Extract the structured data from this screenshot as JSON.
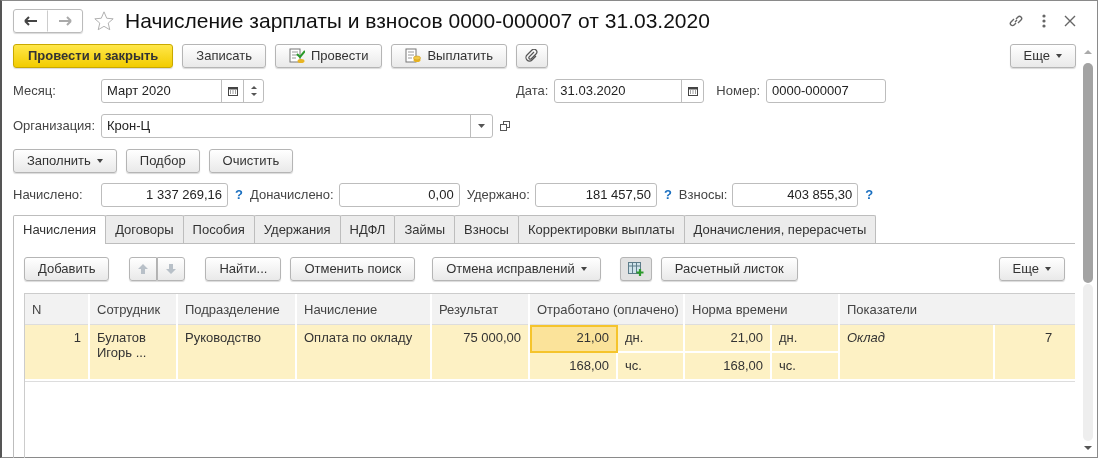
{
  "window": {
    "title": "Начисление зарплаты и взносов 0000-000007 от 31.03.2020",
    "favorite": false
  },
  "toolbar": [
    {
      "label": "Провести и закрыть",
      "kind": "primary"
    },
    {
      "label": "Записать",
      "kind": "plain"
    },
    {
      "label": "Провести",
      "kind": "post"
    },
    {
      "label": "Выплатить",
      "kind": "pay"
    },
    {
      "kind": "attach"
    }
  ],
  "toolbar_more": "Еще",
  "month": {
    "label": "Месяц:",
    "value": "Март 2020"
  },
  "date": {
    "label": "Дата:",
    "value": "31.03.2020"
  },
  "number": {
    "label": "Номер:",
    "value": "0000-000007"
  },
  "organization": {
    "label": "Организация:",
    "value": "Крон-Ц"
  },
  "fill_buttons": [
    {
      "label": "Заполнить",
      "dropdown": true
    },
    {
      "label": "Подбор",
      "dropdown": false
    },
    {
      "label": "Очистить",
      "dropdown": false
    }
  ],
  "totals": [
    {
      "label": "Начислено:",
      "value": "1 337 269,16",
      "help": "?"
    },
    {
      "label": "Доначислено:",
      "value": "0,00"
    },
    {
      "label": "Удержано:",
      "value": "181 457,50",
      "help": "?"
    },
    {
      "label": "Взносы:",
      "value": "403 855,30",
      "help": "?"
    }
  ],
  "tabs": [
    {
      "label": "Начисления",
      "selected": true
    },
    {
      "label": "Договоры",
      "selected": false
    },
    {
      "label": "Пособия",
      "selected": false
    },
    {
      "label": "Удержания",
      "selected": false
    },
    {
      "label": "НДФЛ",
      "selected": false
    },
    {
      "label": "Займы",
      "selected": false
    },
    {
      "label": "Взносы",
      "selected": false
    },
    {
      "label": "Корректировки выплаты",
      "selected": false
    },
    {
      "label": "Доначисления, перерасчеты",
      "selected": false
    }
  ],
  "table_toolbar": [
    {
      "kind": "text",
      "label": "Добавить"
    },
    {
      "kind": "updown"
    },
    {
      "kind": "text",
      "label": "Найти..."
    },
    {
      "kind": "text",
      "label": "Отменить поиск"
    },
    {
      "kind": "dropdown",
      "label": "Отмена исправлений"
    },
    {
      "kind": "grid-add",
      "pressed": true
    },
    {
      "kind": "text",
      "label": "Расчетный листок"
    }
  ],
  "table_more": "Еще",
  "table": {
    "columns": [
      "N",
      "Сотрудник",
      "Подразделение",
      "Начисление",
      "Результат",
      "Отработано (оплачено)",
      "Норма времени",
      "Показатели"
    ],
    "rows": [
      {
        "n": "1",
        "employee": "Булатов Игорь ...",
        "department": "Руководство",
        "accrual": "Оплата по окладу",
        "result": "75 000,00",
        "selected": true,
        "worked": [
          {
            "value": "21,00",
            "unit": "дн.",
            "focused": true
          },
          {
            "value": "168,00",
            "unit": "чс.",
            "focused": false
          }
        ],
        "norm": [
          {
            "value": "21,00",
            "unit": "дн."
          },
          {
            "value": "168,00",
            "unit": "чс."
          }
        ],
        "indicator": "Оклад",
        "indicator_value": "7"
      }
    ]
  }
}
